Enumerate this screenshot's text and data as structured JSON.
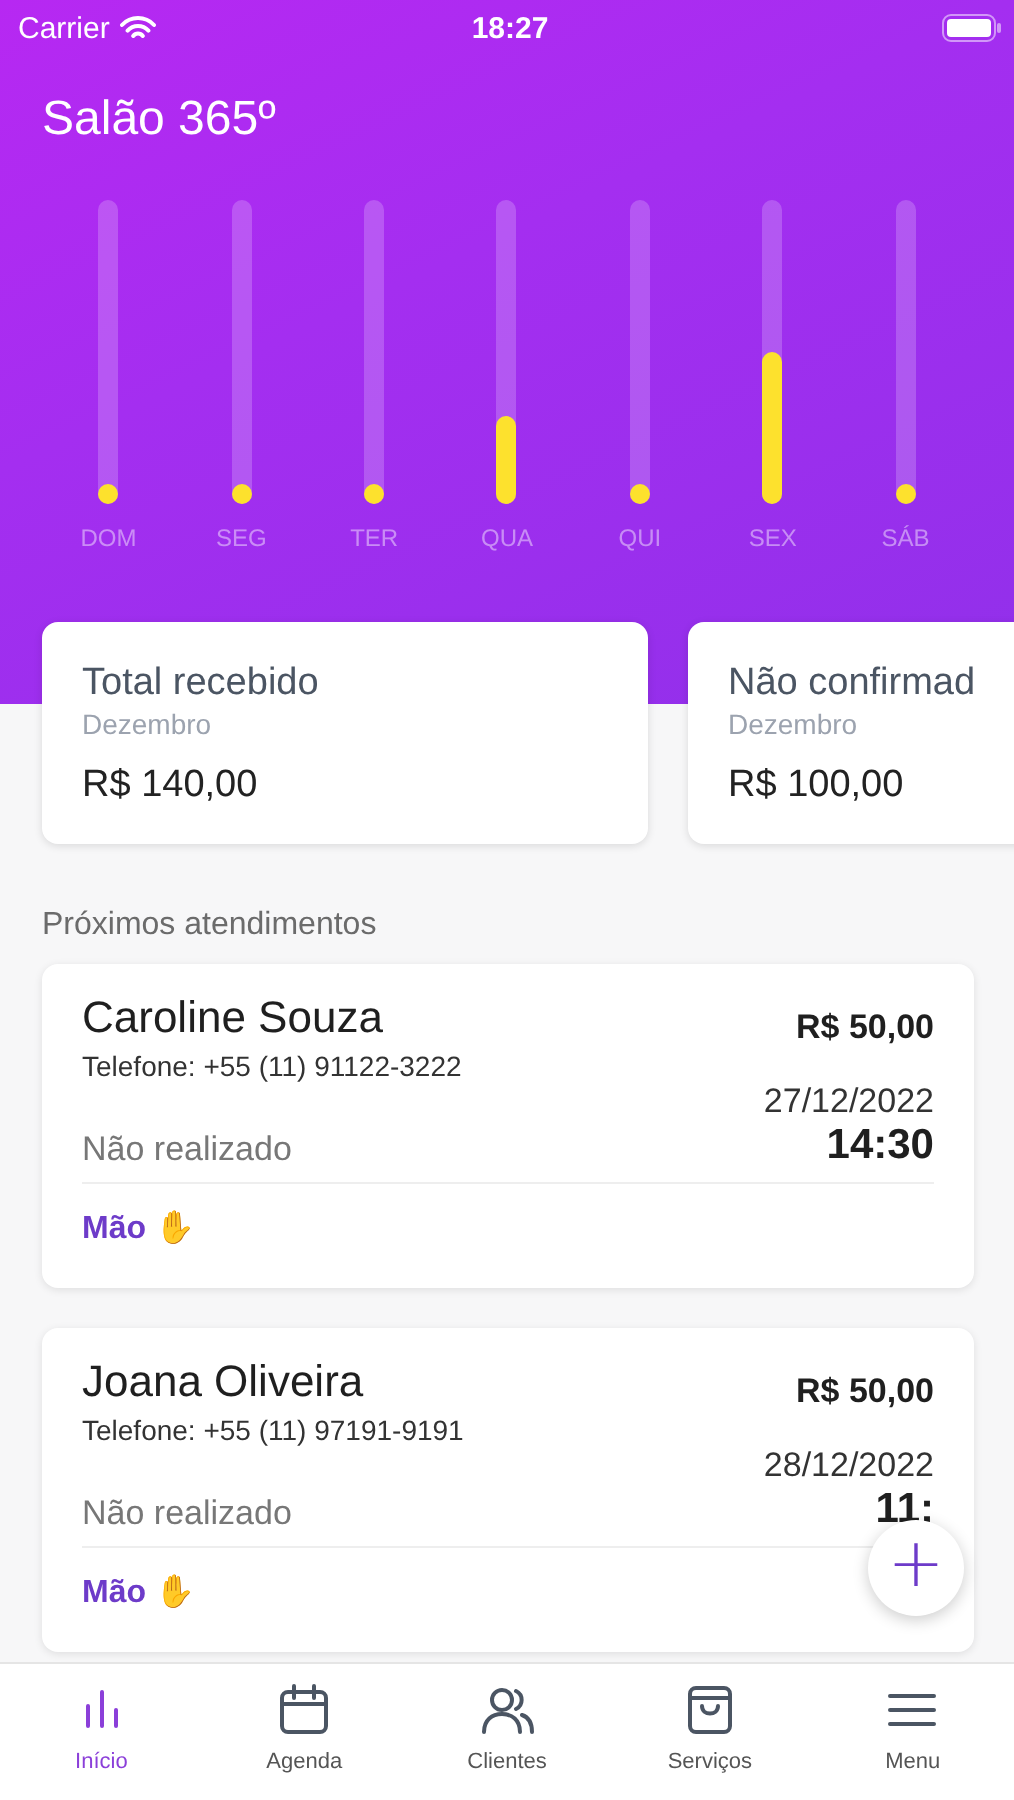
{
  "status_bar": {
    "carrier": "Carrier",
    "time": "18:27"
  },
  "title": "Salão 365º",
  "days": [
    {
      "label": "DOM",
      "level": 0
    },
    {
      "label": "SEG",
      "level": 0
    },
    {
      "label": "TER",
      "level": 0
    },
    {
      "label": "QUA",
      "level": 0.29
    },
    {
      "label": "QUI",
      "level": 0
    },
    {
      "label": "SEX",
      "level": 0.5
    },
    {
      "label": "SÁB",
      "level": 0
    }
  ],
  "summary_cards": [
    {
      "title": "Total recebido",
      "period": "Dezembro",
      "amount": "R$ 140,00"
    },
    {
      "title": "Não confirmad",
      "period": "Dezembro",
      "amount": "R$ 100,00"
    }
  ],
  "section_title": "Próximos atendimentos",
  "appointments": [
    {
      "name": "Caroline Souza",
      "phone": "Telefone: +55 (11) 91122-3222",
      "price": "R$ 50,00",
      "date": "27/12/2022",
      "time": "14:30",
      "status": "Não realizado",
      "service": "Mão ✋"
    },
    {
      "name": "Joana Oliveira",
      "phone": "Telefone: +55 (11) 97191-9191",
      "price": "R$ 50,00",
      "date": "28/12/2022",
      "time": "11:",
      "status": "Não realizado",
      "service": "Mão ✋"
    }
  ],
  "fab": "+",
  "tabs": [
    {
      "label": "Início",
      "selected": true
    },
    {
      "label": "Agenda",
      "selected": false
    },
    {
      "label": "Clientes",
      "selected": false
    },
    {
      "label": "Serviços",
      "selected": false
    },
    {
      "label": "Menu",
      "selected": false
    }
  ]
}
